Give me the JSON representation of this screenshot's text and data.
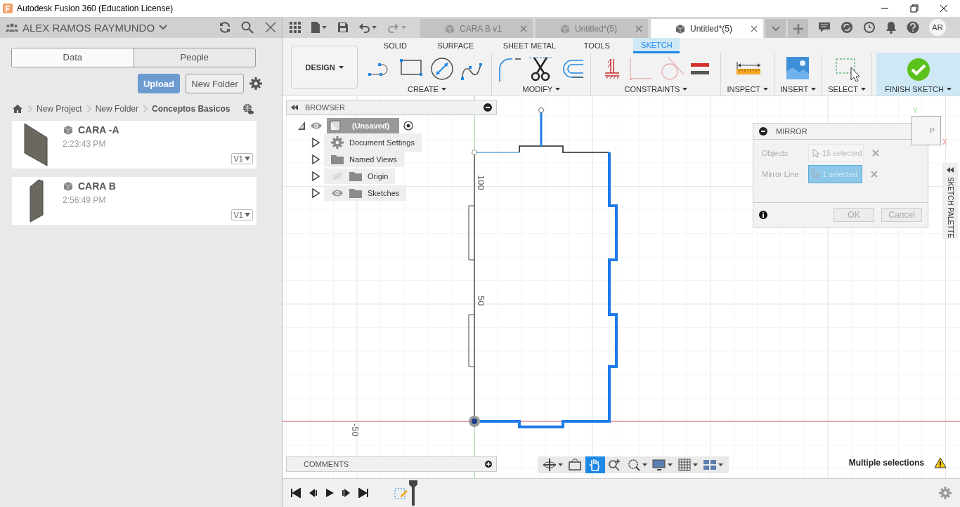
{
  "window": {
    "title": "Autodesk Fusion 360 (Education License)"
  },
  "data_panel": {
    "user": "ALEX RAMOS RAYMUNDO",
    "tabs": [
      {
        "label": "Data",
        "selected": true
      },
      {
        "label": "People",
        "selected": false
      }
    ],
    "upload_button": "Upload",
    "new_folder_button": "New Folder",
    "breadcrumb": [
      "New Project",
      "New Folder",
      "Conceptos Basicos"
    ],
    "files": [
      {
        "name": "CARA -A",
        "time": "2:23:43 PM",
        "version": "V1"
      },
      {
        "name": "CARA B",
        "time": "2:56:49 PM",
        "version": "V1"
      }
    ]
  },
  "document_tabs": [
    {
      "label": "CARA B v1",
      "selected": false
    },
    {
      "label": "Untitled*(5)",
      "selected": false
    },
    {
      "label": "Untitled*(5)",
      "selected": true
    }
  ],
  "profile": {
    "initials": "AR"
  },
  "workspace": "DESIGN",
  "toolbar_tabs": [
    {
      "label": "SOLID",
      "selected": false
    },
    {
      "label": "SURFACE",
      "selected": false
    },
    {
      "label": "SHEET METAL",
      "selected": false
    },
    {
      "label": "TOOLS",
      "selected": false
    },
    {
      "label": "SKETCH",
      "selected": true
    }
  ],
  "tool_groups": [
    {
      "label": "CREATE",
      "kind": "tools"
    },
    {
      "label": "MODIFY",
      "kind": "tools"
    },
    {
      "label": "CONSTRAINTS",
      "kind": "tools"
    },
    {
      "label": "INSPECT",
      "kind": "tools"
    },
    {
      "label": "INSERT",
      "kind": "tools"
    },
    {
      "label": "SELECT",
      "kind": "tools"
    },
    {
      "label": "FINISH SKETCH",
      "kind": "finish"
    }
  ],
  "browser": {
    "title": "BROWSER",
    "root": {
      "label": "(Unsaved)",
      "expanded": true,
      "visible": true,
      "children": [
        {
          "label": "Document Settings",
          "kind": "settings",
          "expanded": false
        },
        {
          "label": "Named Views",
          "kind": "folder",
          "expanded": false
        },
        {
          "label": "Origin",
          "kind": "folder",
          "expanded": false,
          "visible": false
        },
        {
          "label": "Sketches",
          "kind": "folder",
          "expanded": false,
          "visible": true
        }
      ]
    }
  },
  "dimension_labels": [
    "100",
    "50",
    "-50"
  ],
  "view_cube": {
    "face": "P",
    "y_axis": "Y",
    "x_axis": "X"
  },
  "mirror_dialog": {
    "title": "MIRROR",
    "fields": [
      {
        "label": "Objects",
        "value": "15 selected",
        "selected": false
      },
      {
        "label": "Mirror Line",
        "value": "1 selected",
        "selected": true
      }
    ],
    "ok": "OK",
    "cancel": "Cancel"
  },
  "sketch_palette": "SKETCH PALETTE",
  "comments": "COMMENTS",
  "navigation_tools": [
    {
      "selected": false
    },
    {
      "selected": false
    },
    {
      "selected": true
    },
    {
      "selected": false
    },
    {
      "selected": false
    },
    {
      "selected": false
    },
    {
      "selected": false
    },
    {
      "selected": false
    }
  ],
  "status": "Multiple selections"
}
